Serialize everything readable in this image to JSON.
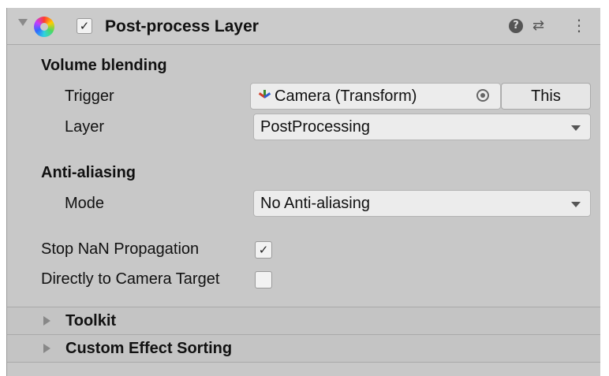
{
  "component": {
    "title": "Post-process Layer",
    "enabled": true,
    "enabled_mark": "✓",
    "icons": [
      "foldout-arrow-icon",
      "color-wheel-icon",
      "help-icon",
      "presets-icon",
      "kebab-menu-icon"
    ],
    "help_glyph": "?",
    "sliders_glyph": "⇄",
    "kebab_glyph": "⋮"
  },
  "volume_blending": {
    "heading": "Volume blending",
    "trigger": {
      "label": "Trigger",
      "value": "Camera (Transform)",
      "this_button": "This"
    },
    "layer": {
      "label": "Layer",
      "value": "PostProcessing"
    }
  },
  "anti_aliasing": {
    "heading": "Anti-aliasing",
    "mode": {
      "label": "Mode",
      "value": "No Anti-aliasing"
    }
  },
  "stop_nan": {
    "label": "Stop NaN Propagation",
    "checked": true,
    "mark": "✓"
  },
  "direct_to_camera": {
    "label": "Directly to Camera Target",
    "checked": false,
    "mark": ""
  },
  "foldouts": [
    {
      "label": "Toolkit",
      "expanded": false
    },
    {
      "label": "Custom Effect Sorting",
      "expanded": false
    }
  ],
  "colors": {
    "panel_bg": "#c8c8c8",
    "field_bg": "#ececec",
    "header_bg": "#cbcbcb"
  }
}
